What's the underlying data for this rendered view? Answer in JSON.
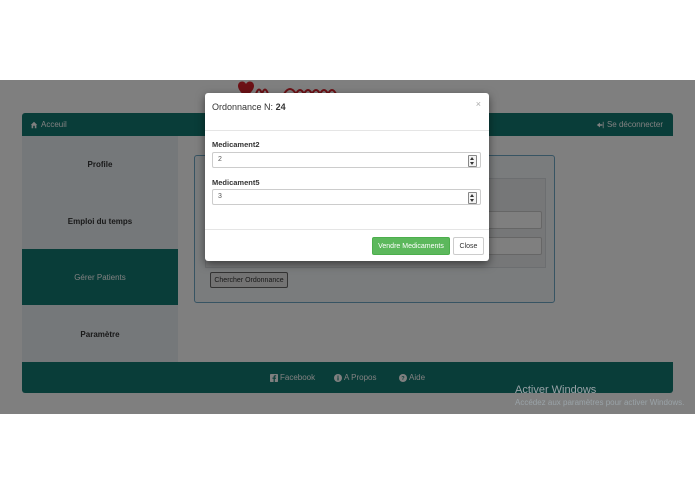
{
  "navbar": {
    "home_label": "Acceuil",
    "logout_label": "Se déconnecter"
  },
  "sidebar": {
    "items": [
      {
        "label": "Profile"
      },
      {
        "label": "Emploi du temps"
      },
      {
        "label": "Gérer Patients"
      },
      {
        "label": "Paramètre"
      }
    ]
  },
  "panel": {
    "search_button": "Chercher Ordonnance"
  },
  "footer": {
    "facebook": "Facebook",
    "about": "A Propos",
    "help": "Aide"
  },
  "watermark": {
    "title": "Activer Windows",
    "subtitle": "Accédez aux paramètres pour activer Windows."
  },
  "modal": {
    "title_prefix": "Ordonnance N:",
    "title_number": "24",
    "close_symbol": "×",
    "fields": [
      {
        "label": "Medicament2",
        "value": "2"
      },
      {
        "label": "Medicament5",
        "value": "3"
      }
    ],
    "primary_button": "Vendre Medicaments",
    "close_button": "Close"
  },
  "colors": {
    "primary": "#137a72",
    "success": "#5cb85c",
    "overlay": "rgba(0,0,0,0.5)"
  }
}
